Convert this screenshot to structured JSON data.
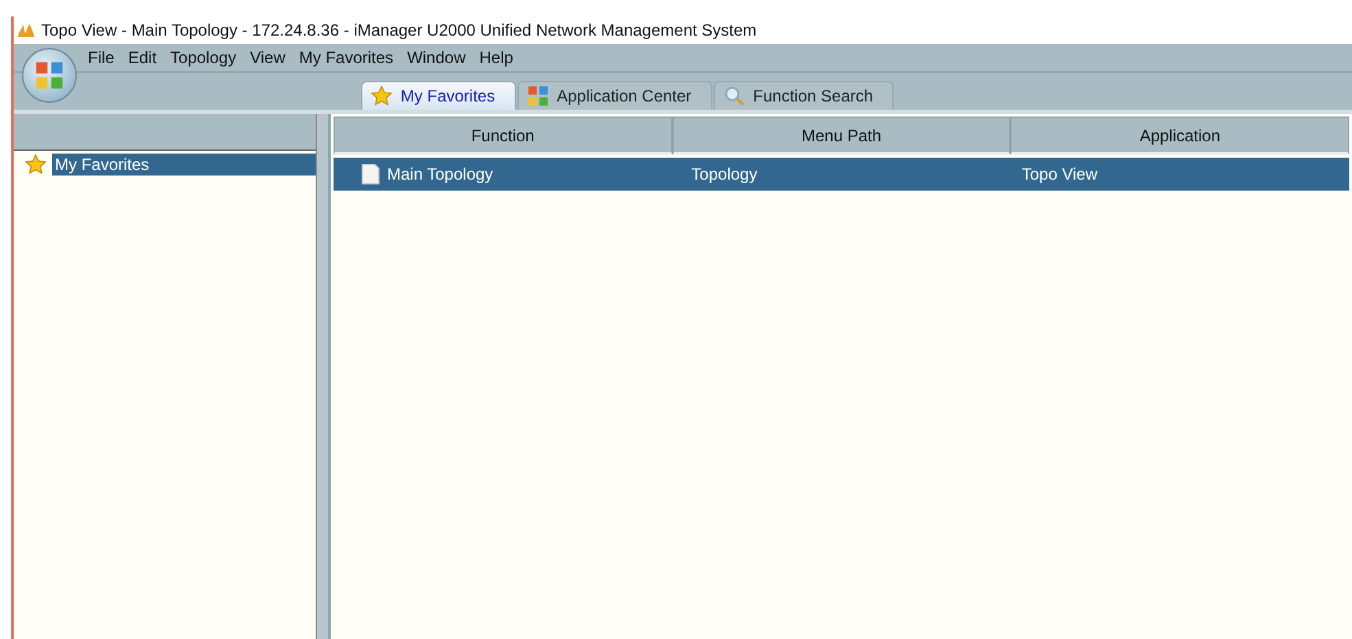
{
  "window": {
    "title": "Topo View - Main Topology - 172.24.8.36 - iManager U2000 Unified Network Management System"
  },
  "menu": [
    "File",
    "Edit",
    "Topology",
    "View",
    "My Favorites",
    "Window",
    "Help"
  ],
  "tabs": [
    {
      "label": "My Favorites",
      "kind": "star",
      "selected": true
    },
    {
      "label": "Application Center",
      "kind": "grid",
      "selected": false
    },
    {
      "label": "Function Search",
      "kind": "search",
      "selected": false
    }
  ],
  "tree": {
    "items": [
      {
        "label": "My Favorites",
        "selected": true
      }
    ]
  },
  "table": {
    "columns": [
      "Function",
      "Menu Path",
      "Application"
    ],
    "rows": [
      {
        "cells": [
          "Main Topology",
          "Topology",
          "Topo View"
        ],
        "selected": true
      }
    ]
  }
}
